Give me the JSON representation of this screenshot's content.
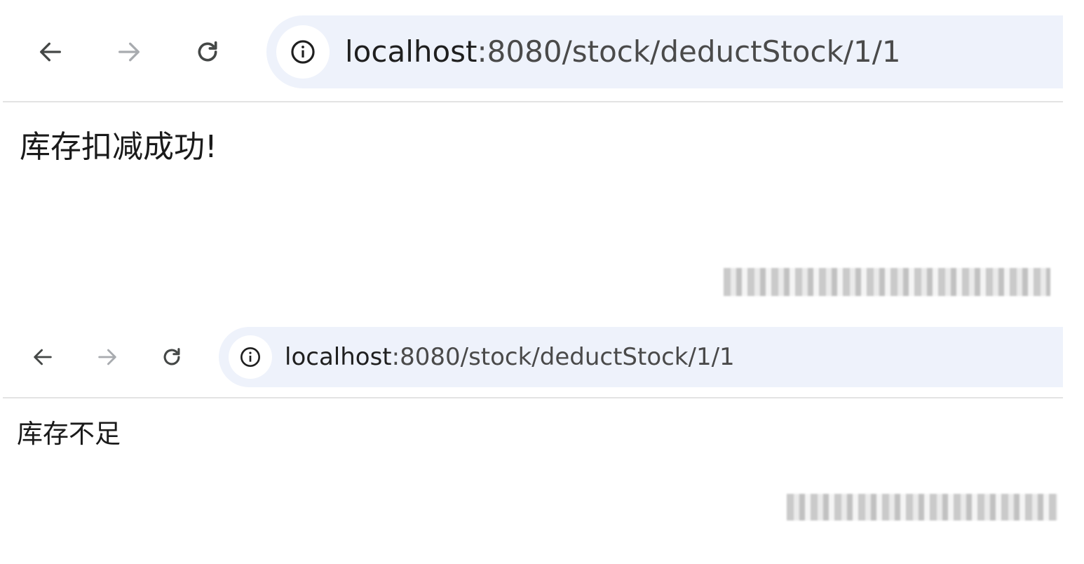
{
  "panels": [
    {
      "nav": {
        "back_icon": "arrow-left-icon",
        "forward_icon": "arrow-right-icon",
        "reload_icon": "reload-icon",
        "site_info_icon": "info-icon"
      },
      "address": {
        "host": "localhost",
        "path": ":8080/stock/deductStock/1/1"
      },
      "page": {
        "message": "库存扣减成功!"
      }
    },
    {
      "nav": {
        "back_icon": "arrow-left-icon",
        "forward_icon": "arrow-right-icon",
        "reload_icon": "reload-icon",
        "site_info_icon": "info-icon"
      },
      "address": {
        "host": "localhost",
        "path": ":8080/stock/deductStock/1/1"
      },
      "page": {
        "message": "库存不足"
      }
    }
  ],
  "colors": {
    "urlbar_bg": "#eef2fb",
    "icon_active": "#444746",
    "icon_disabled": "#a8abaf",
    "divider": "#e3e3e3"
  }
}
